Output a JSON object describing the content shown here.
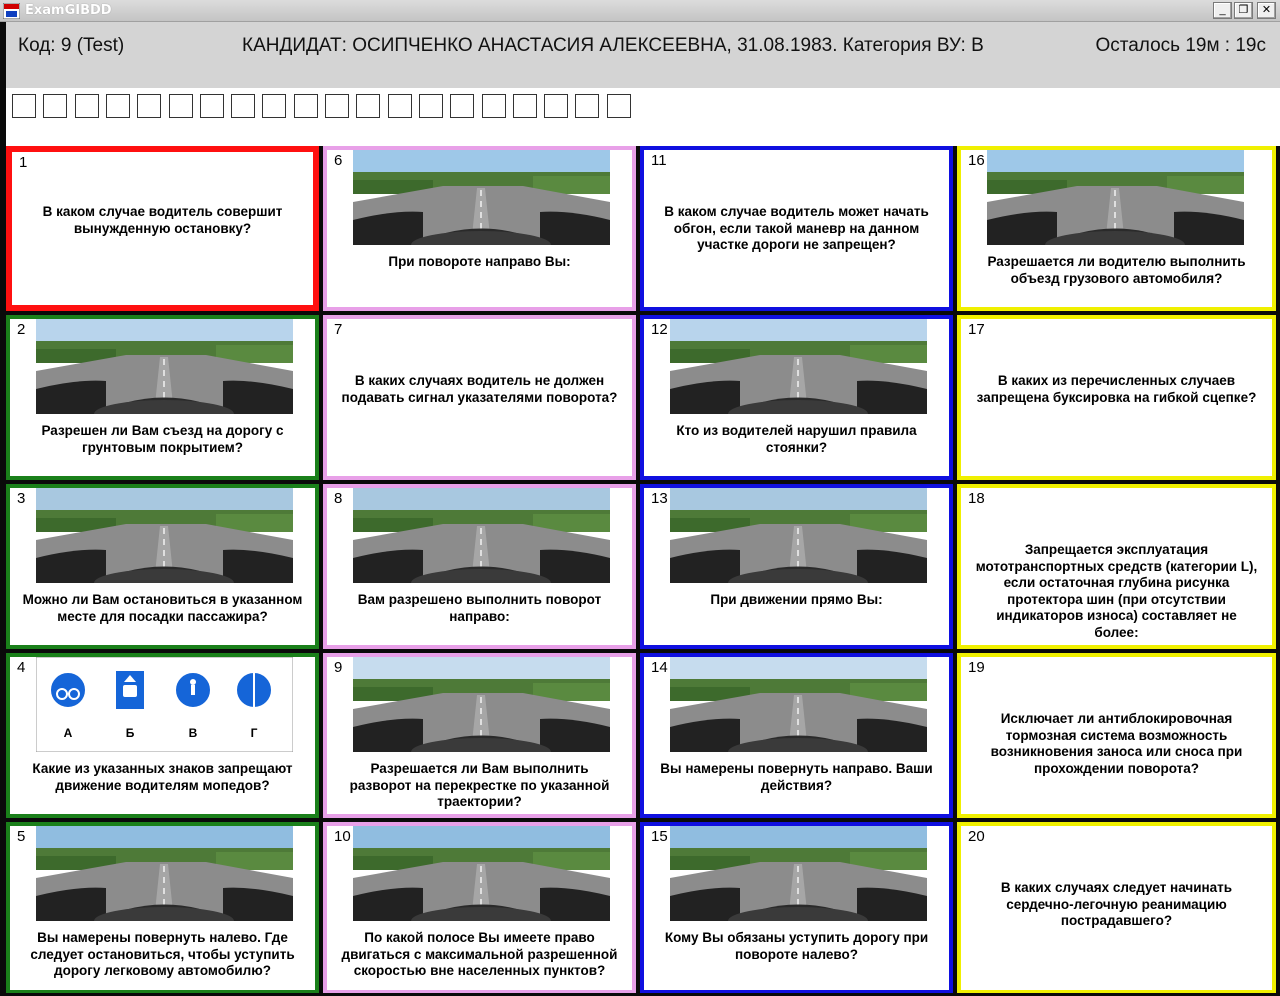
{
  "window": {
    "title": "ExamGIBDD",
    "controls": {
      "minimize": "_",
      "maximize": "❐",
      "close": "✕"
    }
  },
  "header": {
    "code": "Код: 9 (Test)",
    "candidate": "КАНДИДАТ: ОСИПЧЕНКО АНАСТАСИЯ АЛЕКСЕЕВНА, 31.08.1983. Категория ВУ: В",
    "timer": "Осталось 19м : 19с"
  },
  "progress": {
    "total": 20,
    "answered": 0
  },
  "colors": {
    "selected": "#ff1010",
    "pink": "#e8a0e8",
    "blue": "#1010e0",
    "yellow": "#f0f000",
    "green": "#1a801a",
    "background": "#0a0a0a"
  },
  "questions": [
    {
      "num": "1",
      "text": "В каком случае водитель совершит вынужденную остановку?",
      "image": "none",
      "color": "red"
    },
    {
      "num": "2",
      "text": "Разрешен ли Вам съезд на дорогу с грунтовым покрытием?",
      "image": "road-photo",
      "color": "green"
    },
    {
      "num": "3",
      "text": "Можно ли Вам остановиться в указанном месте для посадки пассажира?",
      "image": "road-photo",
      "color": "green"
    },
    {
      "num": "4",
      "text": "Какие из указанных знаков запрещают движение водителям мопедов?",
      "image": "signs",
      "color": "green",
      "sign_labels": [
        "А",
        "Б",
        "В",
        "Г"
      ]
    },
    {
      "num": "5",
      "text": "Вы намерены повернуть налево. Где следует остановиться, чтобы уступить дорогу легковому автомобилю?",
      "image": "road-photo",
      "color": "green"
    },
    {
      "num": "6",
      "text": "При повороте направо Вы:",
      "image": "road-photo",
      "color": "pink"
    },
    {
      "num": "7",
      "text": "В каких случаях водитель не должен подавать сигнал указателями поворота?",
      "image": "none",
      "color": "pink"
    },
    {
      "num": "8",
      "text": "Вам разрешено выполнить поворот направо:",
      "image": "road-photo",
      "color": "pink"
    },
    {
      "num": "9",
      "text": "Разрешается ли Вам выполнить разворот на перекрестке по указанной траектории?",
      "image": "road-photo",
      "color": "pink"
    },
    {
      "num": "10",
      "text": "По какой полосе Вы имеете право двигаться с максимальной разрешенной скоростью вне населенных пунктов?",
      "image": "road-photo",
      "color": "pink"
    },
    {
      "num": "11",
      "text": "В каком случае водитель может начать обгон, если такой маневр на данном участке дороги не запрещен?",
      "image": "none",
      "color": "blue"
    },
    {
      "num": "12",
      "text": "Кто из водителей нарушил правила стоянки?",
      "image": "road-photo",
      "color": "blue"
    },
    {
      "num": "13",
      "text": "При движении прямо Вы:",
      "image": "road-photo",
      "color": "blue"
    },
    {
      "num": "14",
      "text": "Вы намерены повернуть направо. Ваши действия?",
      "image": "road-photo",
      "color": "blue"
    },
    {
      "num": "15",
      "text": "Кому Вы обязаны уступить дорогу при повороте налево?",
      "image": "road-photo",
      "color": "blue"
    },
    {
      "num": "16",
      "text": "Разрешается ли водителю выполнить объезд грузового автомобиля?",
      "image": "road-photo",
      "color": "yellow"
    },
    {
      "num": "17",
      "text": "В каких из перечисленных случаев запрещена буксировка на гибкой сцепке?",
      "image": "none",
      "color": "yellow"
    },
    {
      "num": "18",
      "text": "Запрещается эксплуатация мототранспортных средств (категории L), если остаточная глубина рисунка протектора шин (при отсутствии индикаторов износа) составляет не более:",
      "image": "none",
      "color": "yellow"
    },
    {
      "num": "19",
      "text": "Исключает ли антиблокировочная тормозная система возможность возникновения заноса или сноса при прохождении поворота?",
      "image": "none",
      "color": "yellow"
    },
    {
      "num": "20",
      "text": "В каких случаях следует начинать сердечно-легочную реанимацию пострадавшего?",
      "image": "none",
      "color": "yellow"
    }
  ]
}
